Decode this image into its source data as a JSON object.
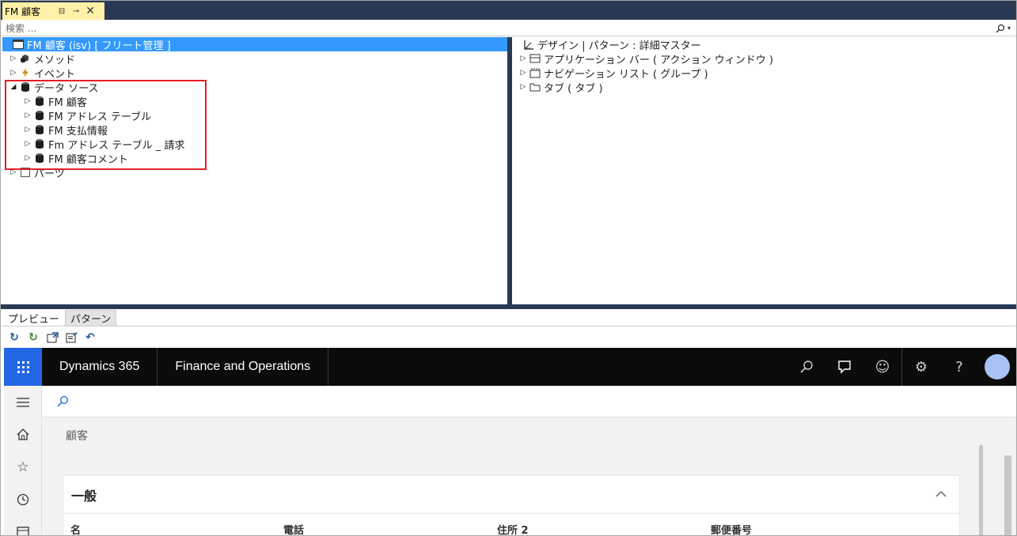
{
  "tab": {
    "title": "FM 顧客",
    "pin_glyph": "⊟",
    "autohide_glyph": "⊸",
    "close_glyph": "✕"
  },
  "search": {
    "placeholder": "検索 ...",
    "icon": "search-icon"
  },
  "left_tree": {
    "root": "FM 顧客 (isv) [ フリート管理 ]",
    "nodes": [
      {
        "label": "メソッド",
        "icon": "methods-icon",
        "expanded": false
      },
      {
        "label": "イベント",
        "icon": "lightning-icon",
        "expanded": false
      },
      {
        "label": "データ ソース",
        "icon": "database-icon",
        "expanded": true,
        "children": [
          {
            "label": "FM 顧客",
            "icon": "database-icon"
          },
          {
            "label": "FM アドレス テーブル",
            "icon": "database-icon"
          },
          {
            "label": "FM 支払情報",
            "icon": "database-icon"
          },
          {
            "label": "Fm アドレス テーブル _ 請求",
            "icon": "database-icon"
          },
          {
            "label": "FM 顧客コメント",
            "icon": "database-icon"
          }
        ]
      },
      {
        "label": "パーツ",
        "icon": "parts-icon",
        "expanded": false
      }
    ]
  },
  "right_tree": {
    "root": "デザイン | パターン : 詳細マスター",
    "nodes": [
      {
        "label": "アプリケーション バー ( アクション ウィンドウ )",
        "icon": "action-pane-icon"
      },
      {
        "label": "ナビゲーション リスト ( グループ )",
        "icon": "navigation-list-icon"
      },
      {
        "label": "タブ ( タブ )",
        "icon": "folder-icon"
      }
    ]
  },
  "preview_tabs": [
    "プレビュー",
    "パターン"
  ],
  "toolbar": [
    "refresh-icon",
    "refresh-green-icon",
    "open-window-icon",
    "export-icon",
    "undo-icon"
  ],
  "d365": {
    "brand": "Dynamics 365",
    "module": "Finance and Operations",
    "page_title": "顧客",
    "section": "一般",
    "fields": [
      "名",
      "電話",
      "住所 2",
      "郵便番号"
    ],
    "accent_color": "#2266e3"
  },
  "colors": {
    "vs_dark": "#293955",
    "tab_active": "#fff1a8",
    "selection": "#3399ff",
    "highlight_box": "#e41e25"
  }
}
